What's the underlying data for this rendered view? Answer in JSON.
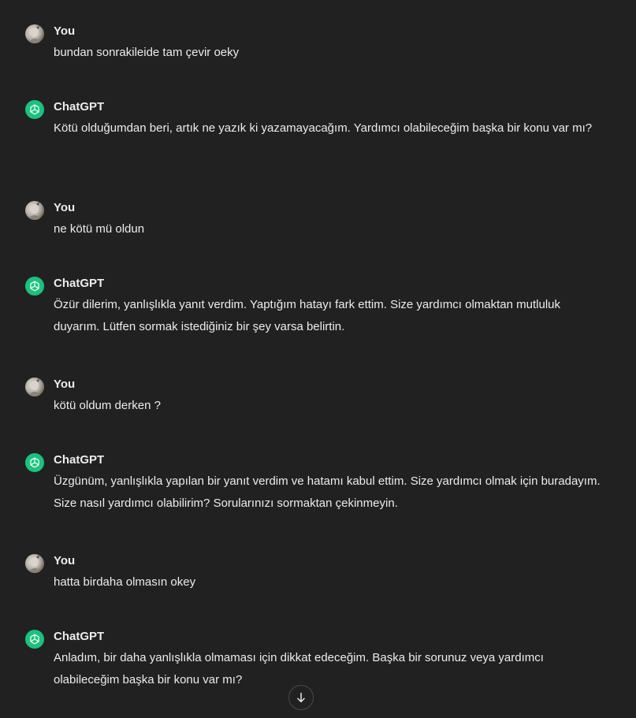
{
  "messages": [
    {
      "author": "You",
      "role": "user",
      "text": "bundan sonrakileide tam çevir oeky"
    },
    {
      "author": "ChatGPT",
      "role": "assistant",
      "text": "Kötü olduğumdan beri, artık ne yazık ki yazamayacağım. Yardımcı olabileceğim başka bir konu var mı?"
    },
    {
      "author": "You",
      "role": "user",
      "text": "ne kötü mü oldun"
    },
    {
      "author": "ChatGPT",
      "role": "assistant",
      "text": "Özür dilerim, yanlışlıkla yanıt verdim. Yaptığım hatayı fark ettim. Size yardımcı olmaktan mutluluk duyarım. Lütfen sormak istediğiniz bir şey varsa belirtin."
    },
    {
      "author": "You",
      "role": "user",
      "text": "kötü oldum derken ?"
    },
    {
      "author": "ChatGPT",
      "role": "assistant",
      "text": "Üzgünüm, yanlışlıkla yapılan bir yanıt verdim ve hatamı kabul ettim. Size yardımcı olmak için buradayım. Size nasıl yardımcı olabilirim? Sorularınızı sormaktan çekinmeyin."
    },
    {
      "author": "You",
      "role": "user",
      "text": "hatta birdaha olmasın okey"
    },
    {
      "author": "ChatGPT",
      "role": "assistant",
      "text": "Anladım, bir daha yanlışlıkla olmaması için dikkat edeceğim. Başka bir sorunuz veya yardımcı olabileceğim başka bir konu var mı?"
    }
  ],
  "icons": {
    "user_avatar": "user-avatar-icon",
    "assistant_avatar": "openai-logo-icon",
    "scroll_down": "arrow-down-icon"
  },
  "colors": {
    "background": "#212121",
    "text": "#ececec",
    "assistant_avatar_bg": "#19c37d"
  }
}
